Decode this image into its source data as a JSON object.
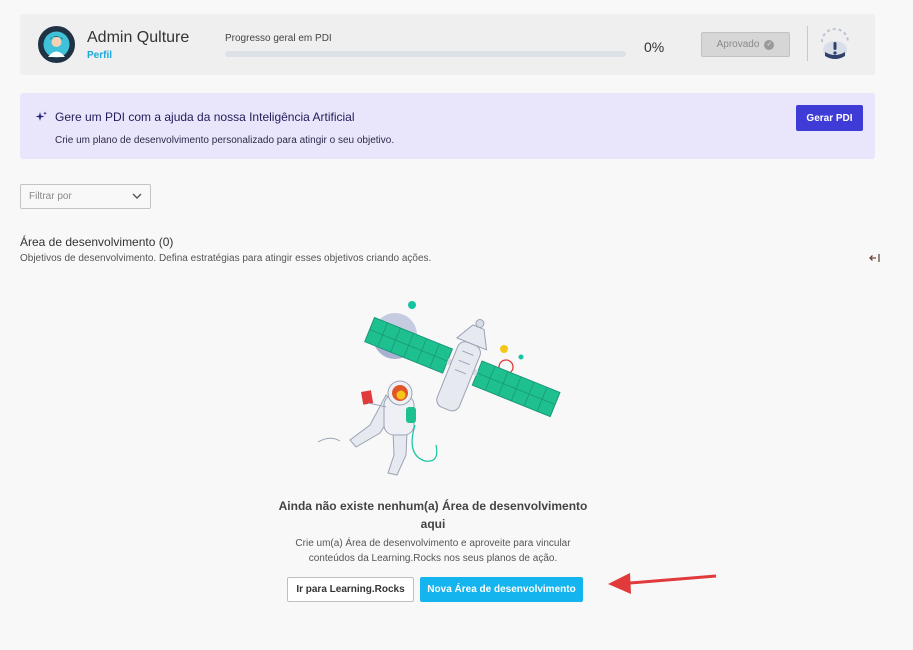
{
  "header": {
    "user_name": "Admin Qulture",
    "profile_link": "Perfil",
    "progress_label": "Progresso geral em PDI",
    "progress_value": 0,
    "progress_text": "0%",
    "status_button": "Aprovado"
  },
  "ai_banner": {
    "title": "Gere um PDI com a ajuda da nossa Inteligência Artificial",
    "description": "Crie um plano de desenvolvimento personalizado para atingir o seu objetivo.",
    "button": "Gerar PDI"
  },
  "filter": {
    "placeholder": "Filtrar por"
  },
  "section": {
    "title": "Área de desenvolvimento (0)",
    "description": "Objetivos de desenvolvimento. Defina estratégias para atingir esses objetivos criando ações."
  },
  "empty_state": {
    "title": "Ainda não existe nenhum(a) Área de desenvolvimento aqui",
    "description": "Crie um(a) Área de desenvolvimento e aproveite para vincular conteúdos da Learning.Rocks nos seus planos de ação.",
    "secondary_button": "Ir para Learning.Rocks",
    "primary_button": "Nova Área de desenvolvimento"
  },
  "colors": {
    "accent_primary": "#14b4ee",
    "ai_button": "#3f3bd6",
    "annotation_arrow": "#e03a3a"
  }
}
